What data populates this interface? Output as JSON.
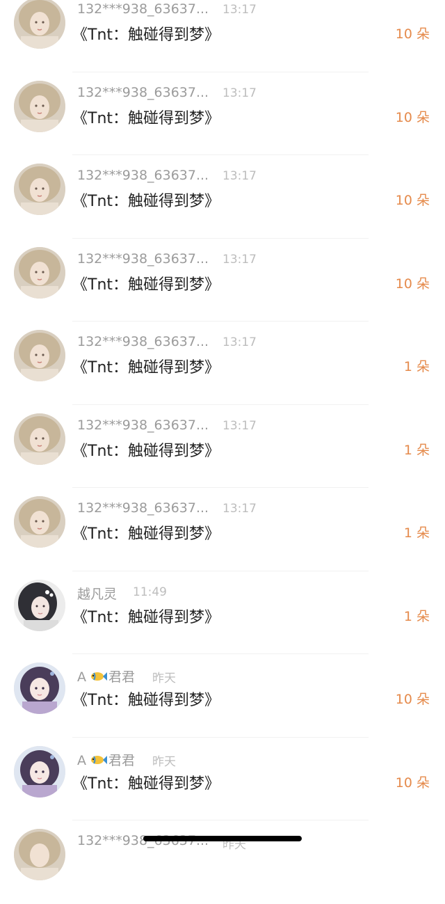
{
  "entries": [
    {
      "name": "132***938_63637...",
      "time": "13:17",
      "title": "《Tnt：触碰得到梦》",
      "amount": "10 朵",
      "avatar": "doll"
    },
    {
      "name": "132***938_63637...",
      "time": "13:17",
      "title": "《Tnt：触碰得到梦》",
      "amount": "10 朵",
      "avatar": "doll"
    },
    {
      "name": "132***938_63637...",
      "time": "13:17",
      "title": "《Tnt：触碰得到梦》",
      "amount": "10 朵",
      "avatar": "doll"
    },
    {
      "name": "132***938_63637...",
      "time": "13:17",
      "title": "《Tnt：触碰得到梦》",
      "amount": "10 朵",
      "avatar": "doll"
    },
    {
      "name": "132***938_63637...",
      "time": "13:17",
      "title": "《Tnt：触碰得到梦》",
      "amount": "1 朵",
      "avatar": "doll"
    },
    {
      "name": "132***938_63637...",
      "time": "13:17",
      "title": "《Tnt：触碰得到梦》",
      "amount": "1 朵",
      "avatar": "doll"
    },
    {
      "name": "132***938_63637...",
      "time": "13:17",
      "title": "《Tnt：触碰得到梦》",
      "amount": "1 朵",
      "avatar": "doll"
    },
    {
      "name": "越凡灵",
      "time": "11:49",
      "title": "《Tnt：触碰得到梦》",
      "amount": "1 朵",
      "avatar": "girl-dark"
    },
    {
      "name_prefix": "A",
      "name": "君君",
      "time": "昨天",
      "title": "《Tnt：触碰得到梦》",
      "amount": "10 朵",
      "avatar": "girl-purple"
    },
    {
      "name_prefix": "A",
      "name": "君君",
      "time": "昨天",
      "title": "《Tnt：触碰得到梦》",
      "amount": "10 朵",
      "avatar": "girl-purple"
    },
    {
      "name": "132***938_63637...",
      "time": "昨天",
      "title": "",
      "amount": "",
      "avatar": "doll"
    }
  ],
  "colors": {
    "amount": "#e58a4b",
    "name": "#9b9b9b",
    "title": "#222222"
  }
}
